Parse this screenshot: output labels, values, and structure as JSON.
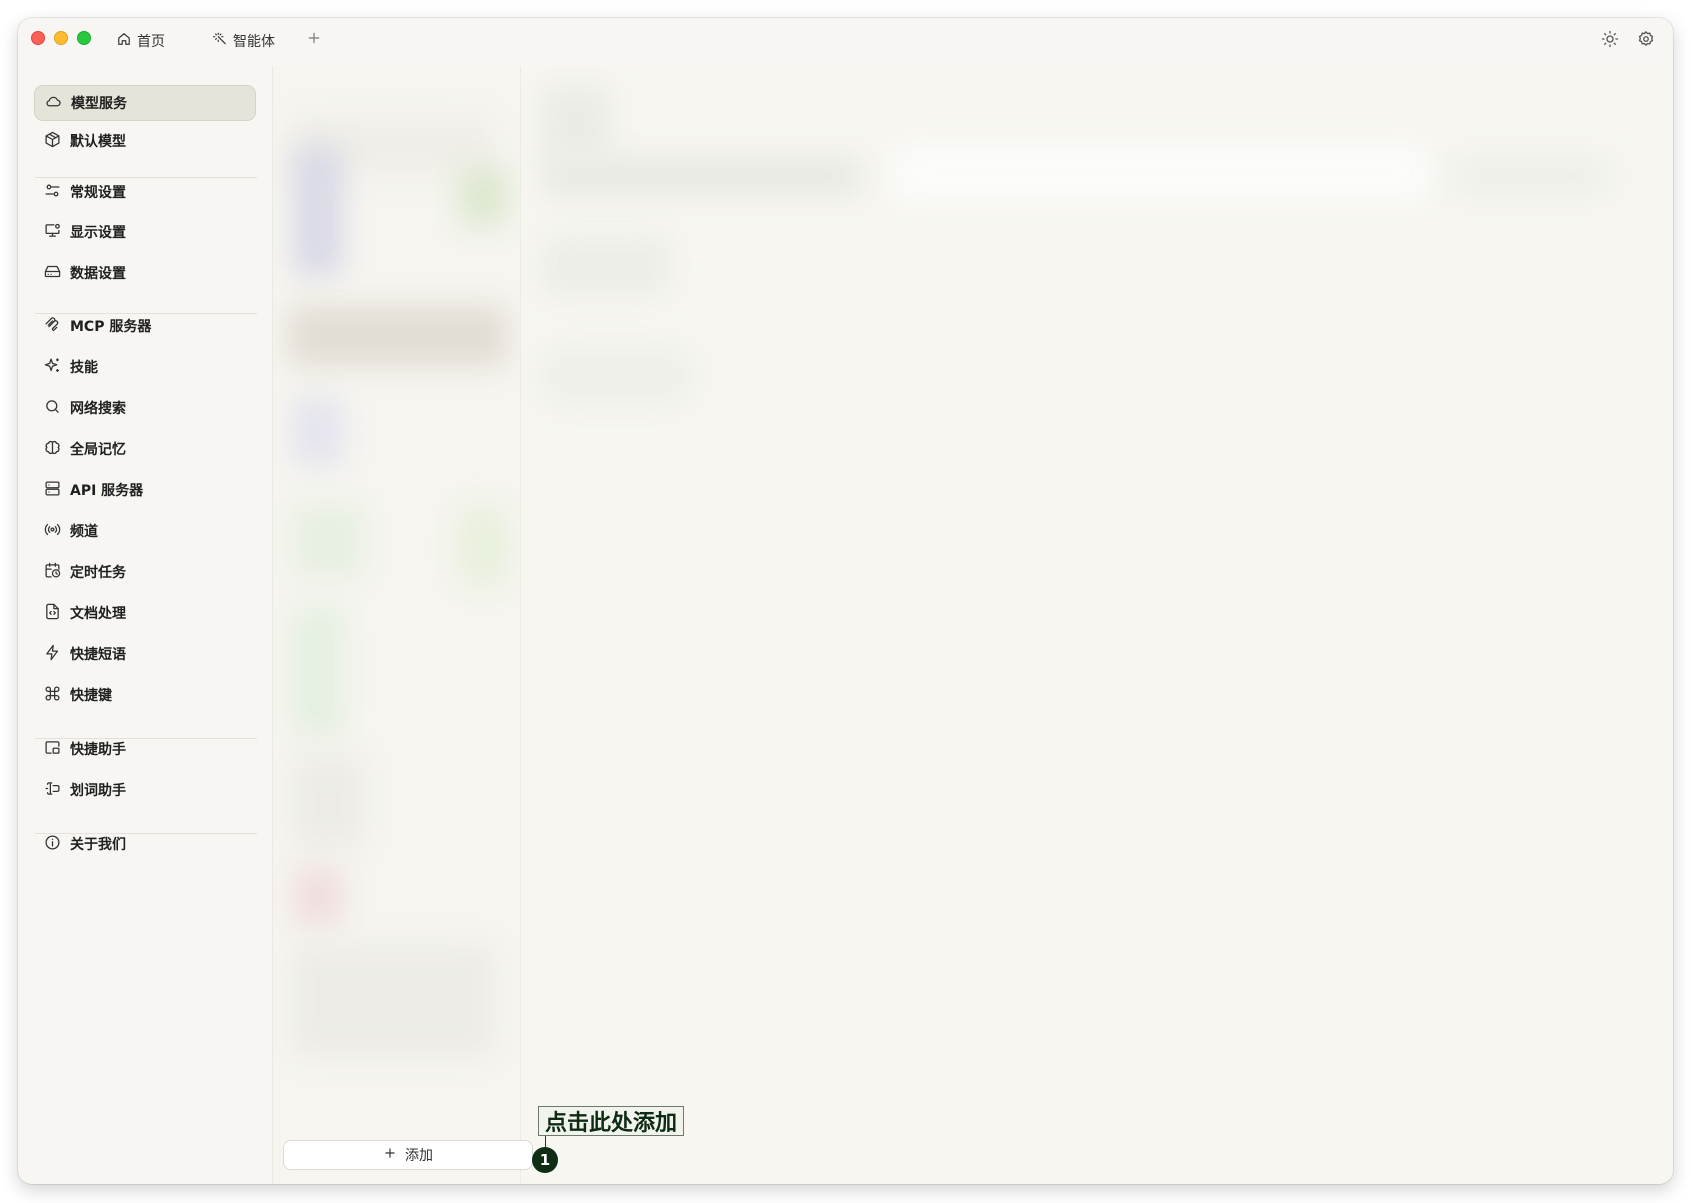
{
  "titlebar": {
    "tabs": [
      {
        "label": "首页",
        "icon": "home-icon"
      },
      {
        "label": "智能体",
        "icon": "sparkle-wand-icon"
      }
    ],
    "new_tab_icon": "plus-icon",
    "right_icons": [
      "sun-icon",
      "gear-icon"
    ]
  },
  "sidebar": {
    "items": [
      {
        "label": "模型服务",
        "icon": "cloud-icon",
        "active": true
      },
      {
        "label": "默认模型",
        "icon": "cube-icon"
      },
      {
        "label": "常规设置",
        "icon": "sliders-icon"
      },
      {
        "label": "显示设置",
        "icon": "monitor-icon"
      },
      {
        "label": "数据设置",
        "icon": "hard-drive-icon"
      },
      {
        "label": "MCP 服务器",
        "icon": "mcp-icon"
      },
      {
        "label": "技能",
        "icon": "sparkles-icon"
      },
      {
        "label": "网络搜索",
        "icon": "search-icon"
      },
      {
        "label": "全局记忆",
        "icon": "brain-icon"
      },
      {
        "label": "API 服务器",
        "icon": "server-icon"
      },
      {
        "label": "频道",
        "icon": "broadcast-icon"
      },
      {
        "label": "定时任务",
        "icon": "calendar-clock-icon"
      },
      {
        "label": "文档处理",
        "icon": "file-code-icon"
      },
      {
        "label": "快捷短语",
        "icon": "zap-icon"
      },
      {
        "label": "快捷键",
        "icon": "command-icon"
      },
      {
        "label": "快捷助手",
        "icon": "app-window-icon"
      },
      {
        "label": "划词助手",
        "icon": "text-cursor-icon"
      },
      {
        "label": "关于我们",
        "icon": "info-icon"
      }
    ]
  },
  "provider_list": {
    "add_button_label": "添加"
  },
  "annotation": {
    "callout_text": "点击此处添加",
    "badge_number": "1"
  },
  "colors": {
    "window_bg": "#f7f6f2",
    "active_item_bg": "#e6e3d9",
    "callout_text": "#0f2a12",
    "badge_bg": "#0f2d14"
  }
}
